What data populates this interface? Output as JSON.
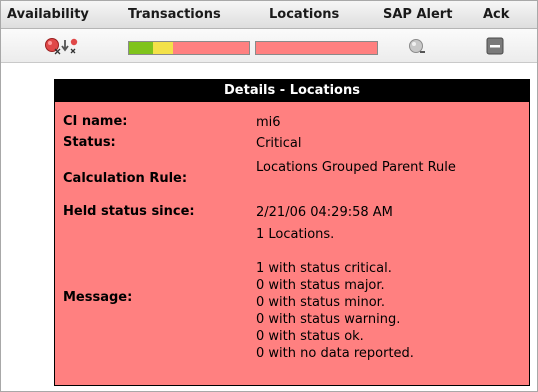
{
  "columns": {
    "availability": "Availability",
    "transactions": "Transactions",
    "locations": "Locations",
    "sap_alert": "SAP Alert",
    "ack": "Ack"
  },
  "status_bars": {
    "transactions": {
      "green": 0.2,
      "yellow": 0.17,
      "red": 0.63
    },
    "locations": {
      "red": 1.0
    }
  },
  "colors": {
    "green": "#7fc31c",
    "yellow": "#f3e149",
    "red": "#ff8080",
    "panel": "#ff8080"
  },
  "icons": {
    "availability": "availability-status-icons",
    "sap_alert": "gray-alert-icon",
    "ack": "acknowledge-icon"
  },
  "details": {
    "title": "Details - Locations",
    "ci_name_label": "CI name:",
    "ci_name": "mi6",
    "status_label": "Status:",
    "status": "Critical",
    "calc_rule_label": "Calculation Rule:",
    "calc_rule": "Locations Grouped Parent Rule",
    "held_label": "Held status since:",
    "held": "2/21/06 04:29:58 AM",
    "message_label": "Message:",
    "message_lines": [
      "1 Locations.",
      "",
      "1 with status critical.",
      "0 with status major.",
      "0 with status minor.",
      "0 with status warning.",
      "0 with status ok.",
      "0 with no data reported."
    ]
  }
}
